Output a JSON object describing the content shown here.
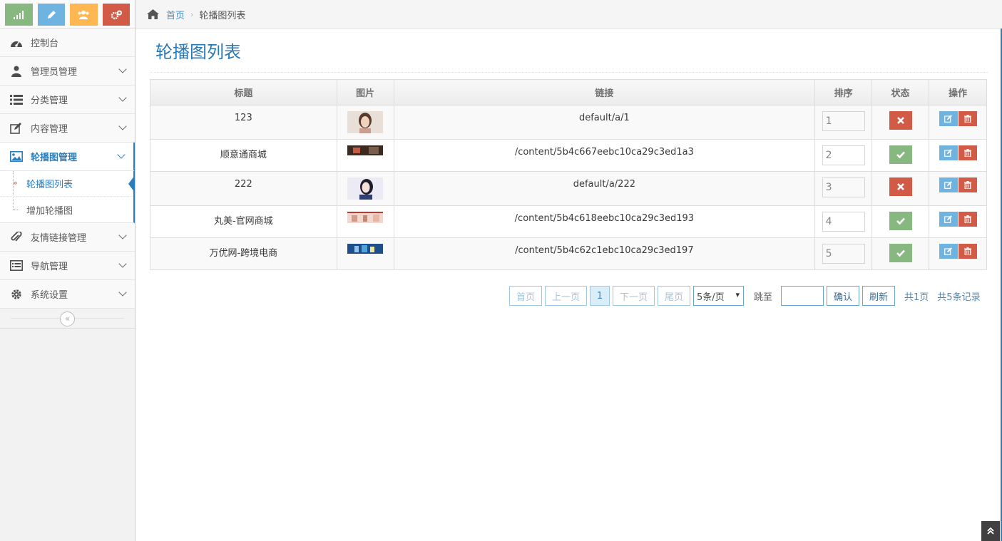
{
  "shortcuts": [
    {
      "icon": "signal-icon",
      "color": "#87b87f"
    },
    {
      "icon": "pencil-icon",
      "color": "#6fb3e0"
    },
    {
      "icon": "users-icon",
      "color": "#ffb752"
    },
    {
      "icon": "cogs-icon",
      "color": "#d15b47"
    }
  ],
  "sidebar": {
    "items": [
      {
        "label": "控制台",
        "icon": "dashboard-icon"
      },
      {
        "label": "管理员管理",
        "icon": "user-md-icon"
      },
      {
        "label": "分类管理",
        "icon": "list-icon"
      },
      {
        "label": "内容管理",
        "icon": "edit-icon"
      },
      {
        "label": "轮播图管理",
        "icon": "picture-icon"
      },
      {
        "label": "友情链接管理",
        "icon": "paperclip-icon"
      },
      {
        "label": "导航管理",
        "icon": "list-alt-icon"
      },
      {
        "label": "系统设置",
        "icon": "gear-icon"
      }
    ],
    "sub_items": [
      {
        "label": "轮播图列表"
      },
      {
        "label": "增加轮播图"
      }
    ]
  },
  "breadcrumb": {
    "home": "首页",
    "current": "轮播图列表"
  },
  "page_title": "轮播图列表",
  "table": {
    "headers": [
      "标题",
      "图片",
      "链接",
      "排序",
      "状态",
      "操作"
    ],
    "rows": [
      {
        "title": "123",
        "link": "default/a/1",
        "sort": "1",
        "status": "off"
      },
      {
        "title": "顺意通商城",
        "link": "/content/5b4c667eebc10ca29c3ed1a3",
        "sort": "2",
        "status": "on"
      },
      {
        "title": "222",
        "link": "default/a/222",
        "sort": "3",
        "status": "off"
      },
      {
        "title": "丸美-官网商城",
        "link": "/content/5b4c618eebc10ca29c3ed193",
        "sort": "4",
        "status": "on"
      },
      {
        "title": "万优网-跨境电商",
        "link": "/content/5b4c62c1ebc10ca29c3ed197",
        "sort": "5",
        "status": "on"
      }
    ]
  },
  "pager": {
    "first": "首页",
    "prev": "上一页",
    "page": "1",
    "next": "下一页",
    "last": "尾页",
    "page_size": "5条/页",
    "jump_label": "跳至",
    "confirm": "确认",
    "refresh": "刷新",
    "total_pages": "共1页",
    "total_records": "共5条记录"
  }
}
